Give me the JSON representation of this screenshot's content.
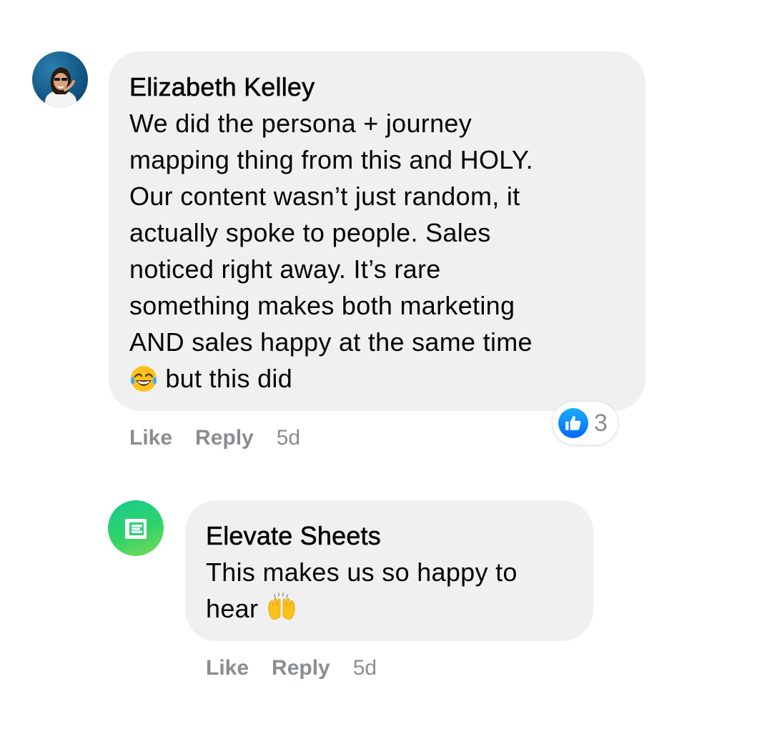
{
  "comments": [
    {
      "author": "Elizabeth Kelley",
      "avatar_icon": "profile-photo",
      "body_lines": [
        "We did the persona + journey",
        "mapping thing from this and HOLY.",
        "Our content wasn’t just random, it",
        "actually spoke to people. Sales",
        "noticed right away. It’s rare",
        "something makes both marketing",
        "AND sales happy at the same time",
        "but this did"
      ],
      "last_line_emoji": "laughing-tears-emoji",
      "actions": {
        "like": "Like",
        "reply": "Reply",
        "time": "5d"
      },
      "reactions": {
        "icon": "thumbs-up-icon",
        "count": "3"
      }
    },
    {
      "author": "Elevate Sheets",
      "avatar_icon": "elevate-sheets-logo",
      "body_lines": [
        "This makes us so happy to",
        "hear"
      ],
      "last_line_emoji": "raising-hands-emoji",
      "actions": {
        "like": "Like",
        "reply": "Reply",
        "time": "5d"
      }
    }
  ],
  "colors": {
    "bubble": "#f0f0f0",
    "meta_text": "#8a8d91",
    "like_blue": "#0866ff",
    "brand_green": "#2fd36a"
  }
}
